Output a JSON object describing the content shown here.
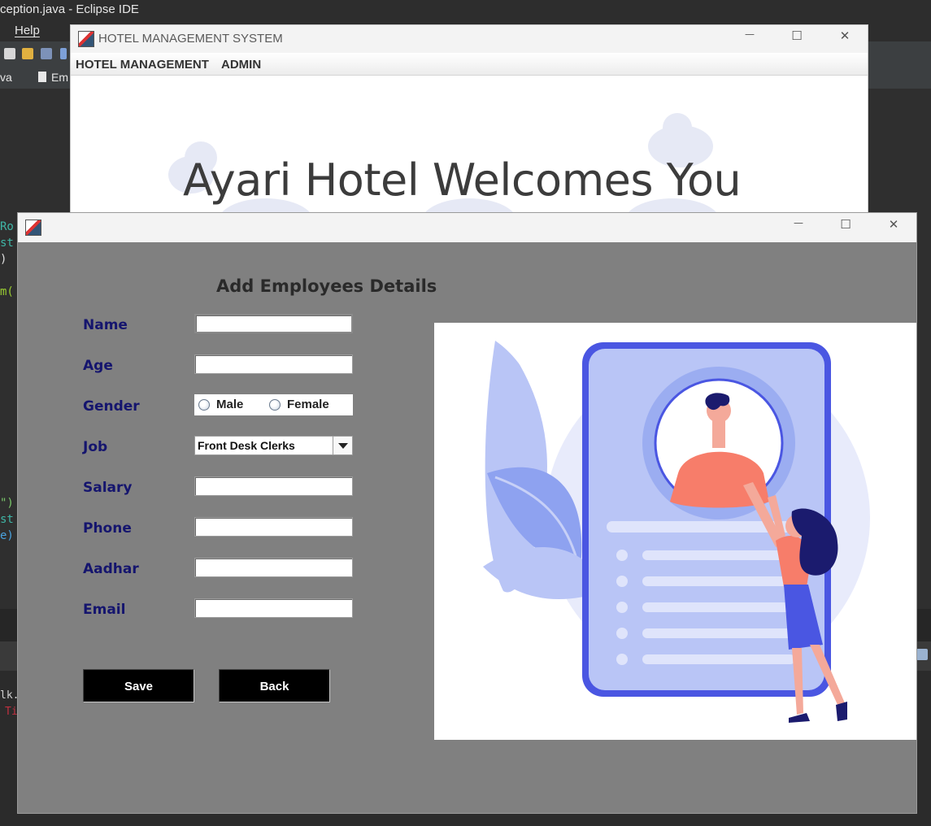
{
  "eclipse": {
    "window_title": "ception.java - Eclipse IDE",
    "menu_help": "Help",
    "tab_left": "va",
    "tab_file": "Em",
    "code_fragments": [
      "Ro",
      "st",
      ")",
      "m(",
      "\")",
      "st",
      "e)"
    ],
    "console_fragment": "lk.h",
    "console_error": "Ti"
  },
  "hotel_window": {
    "title": "HOTEL MANAGEMENT SYSTEM",
    "menu": [
      "HOTEL MANAGEMENT",
      "ADMIN"
    ],
    "welcome_text": "Ayari Hotel Welcomes You"
  },
  "window_controls": {
    "minimize": "—",
    "maximize": "☐",
    "close": "✕"
  },
  "employee_form": {
    "heading": "Add Employees Details",
    "labels": {
      "name": "Name",
      "age": "Age",
      "gender": "Gender",
      "job": "Job",
      "salary": "Salary",
      "phone": "Phone",
      "aadhar": "Aadhar",
      "email": "Email"
    },
    "values": {
      "name": "",
      "age": "",
      "salary": "",
      "phone": "",
      "aadhar": "",
      "email": ""
    },
    "gender_options": [
      "Male",
      "Female"
    ],
    "job_selected": "Front Desk Clerks",
    "save_label": "Save",
    "back_label": "Back"
  },
  "colors": {
    "form_background": "#808080",
    "label_color": "#15156e",
    "button_bg": "#000000",
    "illustration_blue": "#4a56e2",
    "illustration_coral": "#f77d6a"
  }
}
